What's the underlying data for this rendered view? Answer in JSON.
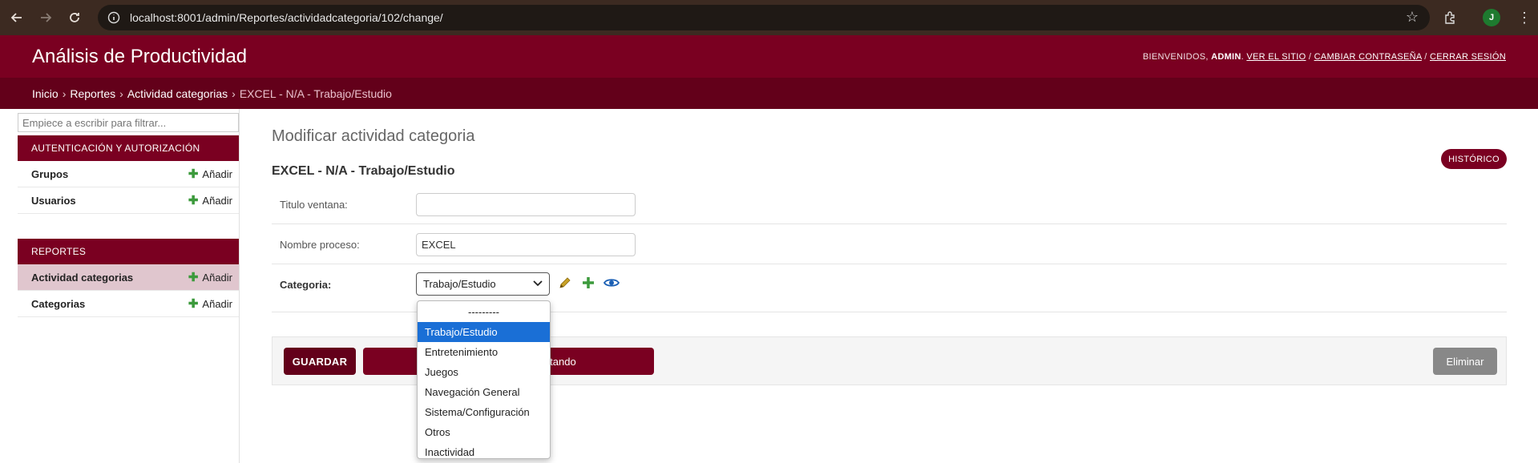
{
  "browser": {
    "url": "localhost:8001/admin/Reportes/actividadcategoria/102/change/",
    "profile_initial": "J"
  },
  "header": {
    "site_title": "Análisis de Productividad",
    "welcome": "BIENVENIDOS,",
    "username": "ADMIN",
    "view_site": "VER EL SITIO",
    "change_password": "CAMBIAR CONTRASEÑA",
    "logout": "CERRAR SESIÓN",
    "separator": "/",
    "accent_color": "#7a0021"
  },
  "breadcrumbs": {
    "items": [
      "Inicio",
      "Reportes",
      "Actividad categorias"
    ],
    "current": "EXCEL - N/A - Trabajo/Estudio",
    "separator": "›"
  },
  "sidebar": {
    "filter_placeholder": "Empiece a escribir para filtrar...",
    "modules": [
      {
        "caption": "Autenticación y autorización",
        "models": [
          {
            "name": "Grupos",
            "add": "Añadir"
          },
          {
            "name": "Usuarios",
            "add": "Añadir"
          }
        ]
      },
      {
        "caption": "Reportes",
        "models": [
          {
            "name": "Actividad categorias",
            "add": "Añadir"
          },
          {
            "name": "Categorias",
            "add": "Añadir"
          }
        ]
      }
    ]
  },
  "main": {
    "heading": "Modificar actividad categoria",
    "history_label": "HISTÓRICO",
    "object_title": "EXCEL - N/A - Trabajo/Estudio",
    "fields": {
      "titulo_label": "Titulo ventana:",
      "titulo_value": "",
      "proceso_label": "Nombre proceso:",
      "proceso_value": "EXCEL",
      "categoria_label": "Categoria:",
      "categoria_value": "Trabajo/Estudio"
    },
    "buttons": {
      "save": "GUARDAR",
      "save_continue": "Guardar y continuar editando",
      "delete": "Eliminar"
    }
  },
  "dropdown": {
    "options": [
      "---------",
      "Trabajo/Estudio",
      "Entretenimiento",
      "Juegos",
      "Navegación General",
      "Sistema/Configuración",
      "Otros",
      "Inactividad"
    ],
    "selected_index": 1
  }
}
